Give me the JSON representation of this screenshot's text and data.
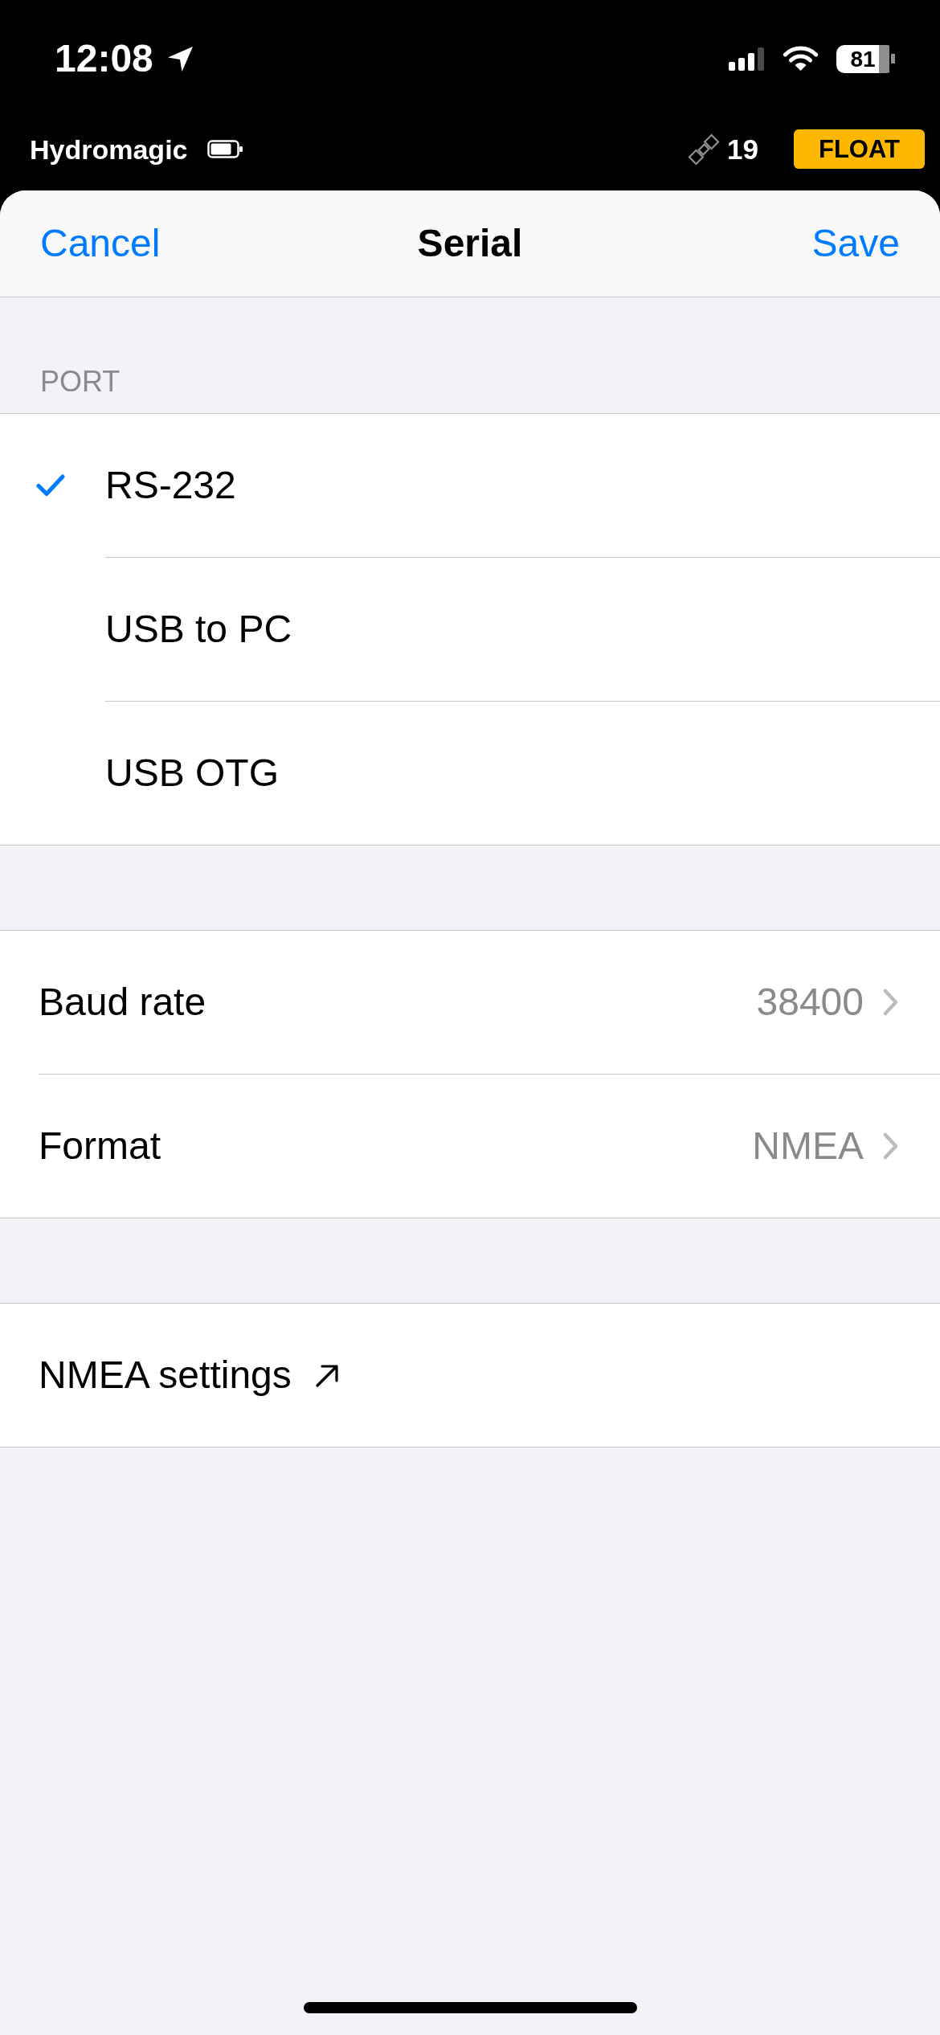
{
  "status_bar": {
    "time": "12:08",
    "battery_percent": "81"
  },
  "app_bar": {
    "app_name": "Hydromagic",
    "satellite_count": "19",
    "fix_status": "FLOAT"
  },
  "nav_bar": {
    "cancel": "Cancel",
    "title": "Serial",
    "save": "Save"
  },
  "sections": [
    {
      "header": "PORT",
      "rows": [
        {
          "kind": "choice",
          "label": "RS-232",
          "selected": true
        },
        {
          "kind": "choice",
          "label": "USB to PC",
          "selected": false
        },
        {
          "kind": "choice",
          "label": "USB OTG",
          "selected": false
        }
      ]
    },
    {
      "rows": [
        {
          "kind": "detail",
          "label": "Baud rate",
          "value": "38400"
        },
        {
          "kind": "detail",
          "label": "Format",
          "value": "NMEA"
        }
      ]
    },
    {
      "rows": [
        {
          "kind": "link",
          "label": "NMEA settings"
        }
      ]
    }
  ]
}
